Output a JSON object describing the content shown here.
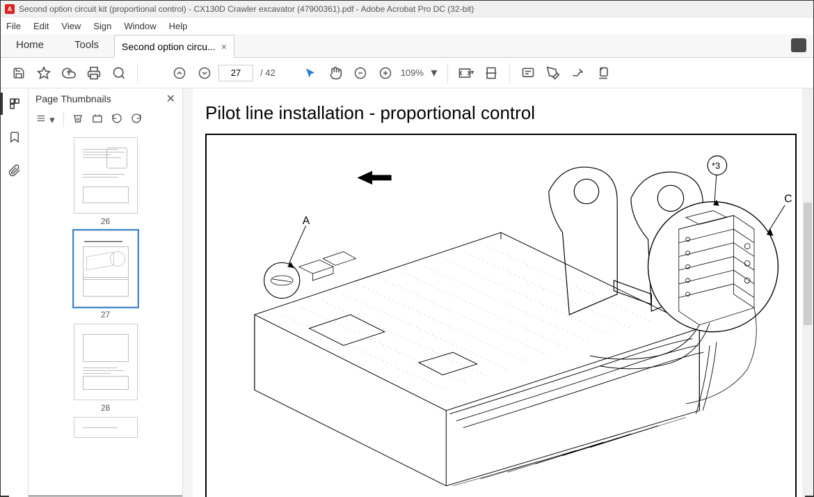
{
  "window": {
    "title": "Second option circuit kit (proportional control) - CX130D Crawler excavator (47900361).pdf - Adobe Acrobat Pro DC (32-bit)",
    "app_icon_letter": "A"
  },
  "menu": {
    "file": "File",
    "edit": "Edit",
    "view": "View",
    "sign": "Sign",
    "window": "Window",
    "help": "Help"
  },
  "tabs": {
    "home": "Home",
    "tools": "Tools",
    "doc_tab": "Second option circu...",
    "doc_tab_close": "×"
  },
  "toolbar": {
    "page_current": "27",
    "page_total": "/ 42",
    "zoom_value": "109%"
  },
  "thumbnails": {
    "title": "Page Thumbnails",
    "close": "✕",
    "pages": [
      {
        "label": "26"
      },
      {
        "label": "27",
        "selected": true
      },
      {
        "label": "28"
      }
    ]
  },
  "document": {
    "heading": "Pilot line installation - proportional control",
    "callouts": {
      "a": "A",
      "star3": "*3",
      "c": "C"
    }
  }
}
